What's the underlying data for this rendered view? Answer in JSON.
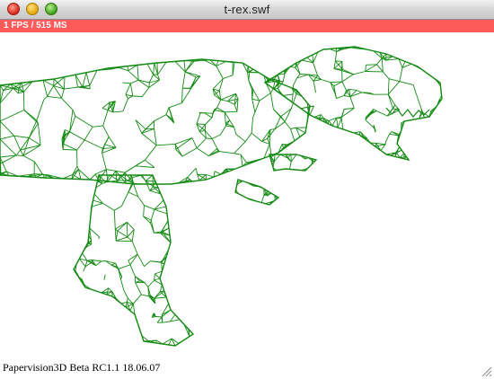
{
  "window": {
    "title": "t-rex.swf"
  },
  "stats": {
    "fps_text": "1 FPS / 515 MS"
  },
  "scene": {
    "model_name": "t-rex",
    "wire_color": "#138a13"
  },
  "footer": {
    "version_text": "Papervision3D Beta RC1.1 18.06.07"
  },
  "colors": {
    "fps_bar": "#ff5a5a",
    "background": "#ffffff"
  },
  "icons": [
    "close-icon",
    "minimize-icon",
    "zoom-icon",
    "resize-grip-icon"
  ]
}
